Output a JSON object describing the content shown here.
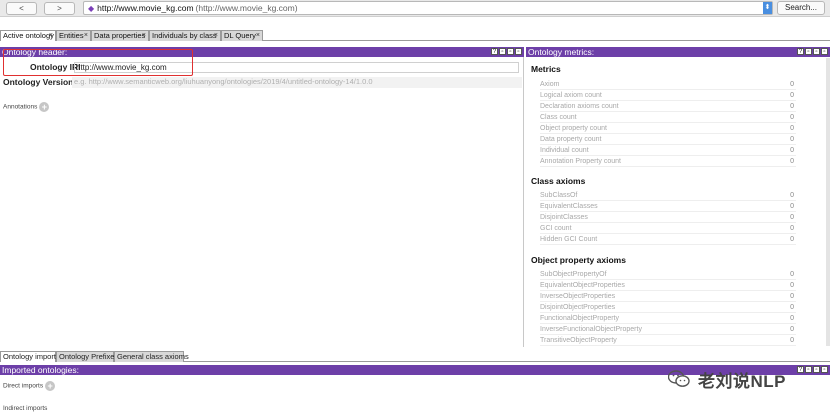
{
  "nav": {
    "back": "<",
    "forward": ">",
    "url_main": "http://www.movie_kg.com",
    "url_sub": "(http://www.movie_kg.com)",
    "search": "Search..."
  },
  "tabs": [
    {
      "label": "Active ontology",
      "close": "×"
    },
    {
      "label": "Entities",
      "close": "×"
    },
    {
      "label": "Data properties",
      "close": "×"
    },
    {
      "label": "Individuals by class",
      "close": "×"
    },
    {
      "label": "DL Query",
      "close": "×"
    }
  ],
  "header": {
    "title": "Ontology header:",
    "iri_label": "Ontology IRI",
    "iri_value": "http://www.movie_kg.com",
    "version_label": "Ontology Version IRI",
    "version_placeholder": "e.g. http://www.semanticweb.org/liuhuanyong/ontologies/2019/4/untitled-ontology-14/1.0.0",
    "annotations_label": "Annotations"
  },
  "metrics": {
    "title": "Ontology metrics:",
    "sections": [
      {
        "title": "Metrics",
        "rows": [
          {
            "label": "Axiom",
            "value": "0"
          },
          {
            "label": "Logical axiom count",
            "value": "0"
          },
          {
            "label": "Declaration axioms count",
            "value": "0"
          },
          {
            "label": "Class count",
            "value": "0"
          },
          {
            "label": "Object property count",
            "value": "0"
          },
          {
            "label": "Data property count",
            "value": "0"
          },
          {
            "label": "Individual count",
            "value": "0"
          },
          {
            "label": "Annotation Property count",
            "value": "0"
          }
        ]
      },
      {
        "title": "Class axioms",
        "rows": [
          {
            "label": "SubClassOf",
            "value": "0"
          },
          {
            "label": "EquivalentClasses",
            "value": "0"
          },
          {
            "label": "DisjointClasses",
            "value": "0"
          },
          {
            "label": "GCI count",
            "value": "0"
          },
          {
            "label": "Hidden GCI Count",
            "value": "0"
          }
        ]
      },
      {
        "title": "Object property axioms",
        "rows": [
          {
            "label": "SubObjectPropertyOf",
            "value": "0"
          },
          {
            "label": "EquivalentObjectProperties",
            "value": "0"
          },
          {
            "label": "InverseObjectProperties",
            "value": "0"
          },
          {
            "label": "DisjointObjectProperties",
            "value": "0"
          },
          {
            "label": "FunctionalObjectProperty",
            "value": "0"
          },
          {
            "label": "InverseFunctionalObjectProperty",
            "value": "0"
          },
          {
            "label": "TransitiveObjectProperty",
            "value": "0"
          }
        ]
      }
    ]
  },
  "bottom_tabs": [
    {
      "label": "Ontology imports"
    },
    {
      "label": "Ontology Prefixes"
    },
    {
      "label": "General class axioms"
    }
  ],
  "imports": {
    "title": "Imported ontologies:",
    "direct_label": "Direct imports",
    "indirect_label": "Indirect imports"
  },
  "watermark": {
    "text": "老刘说NLP"
  },
  "panel_ctrls": [
    "?",
    "▫",
    "▫",
    "▫"
  ],
  "colors": {
    "header_purple": "#6d3fa8",
    "highlight_red": "#e03030"
  }
}
